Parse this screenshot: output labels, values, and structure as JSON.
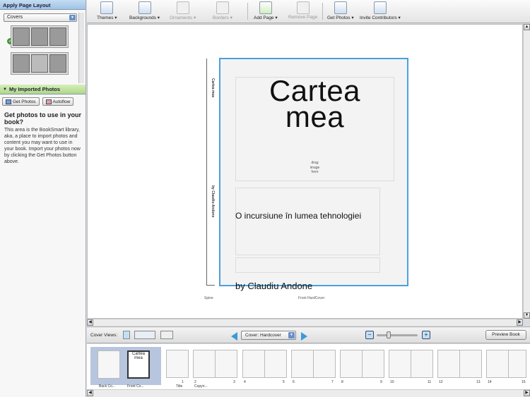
{
  "left_panel": {
    "header": "Apply Page Layout",
    "layout_select": "Covers",
    "photos_header": "My Imported Photos",
    "get_photos_btn": "Get Photos",
    "autoflow_btn": "Autoflow",
    "help_title": "Get photos to use in your book?",
    "help_body": "This area is the BookSmart library, aka, a place to import photos and content you may want to use in your book. Import your photos now by clicking the Get Photos button above."
  },
  "toolbar": {
    "themes": "Themes ▾",
    "backgrounds": "Backgrounds ▾",
    "ornaments": "Ornaments ▾",
    "borders": "Borders ▾",
    "add_page": "Add Page ▾",
    "remove_page": "Remove Page",
    "get_photos": "Get Photos ▾",
    "invite": "Invite Contributors ▾"
  },
  "cover": {
    "title_line1": "Cartea",
    "title_line2": "mea",
    "drag_hint_1": "drag",
    "drag_hint_2": "image",
    "drag_hint_3": "here",
    "subtitle": "O incursiune în lumea tehnologiei",
    "author": "by Claudiu Andone",
    "spine_title": "Cartea mea",
    "spine_author": "by Claudiu Andone",
    "spine_caption": "Spine",
    "front_caption": "Front HardCover"
  },
  "nav": {
    "cover_views_label": "Cover Views:",
    "cover_select": "Cover: Hardcover",
    "preview_btn": "Preview Book"
  },
  "thumbnails": {
    "cover_label_1": "Back Co...",
    "cover_label_2": "Front Co...",
    "mini_title": "Cartea mea",
    "pages": [
      {
        "num": "1",
        "name": "Title"
      },
      {
        "num": "2",
        "name": "Copyri..."
      },
      {
        "num": "3",
        "name": ""
      },
      {
        "num": "4",
        "name": ""
      },
      {
        "num": "5",
        "name": ""
      },
      {
        "num": "6",
        "name": ""
      },
      {
        "num": "7",
        "name": ""
      },
      {
        "num": "8",
        "name": ""
      },
      {
        "num": "9",
        "name": ""
      },
      {
        "num": "10",
        "name": ""
      },
      {
        "num": "11",
        "name": ""
      },
      {
        "num": "12",
        "name": ""
      },
      {
        "num": "13",
        "name": ""
      },
      {
        "num": "14",
        "name": ""
      },
      {
        "num": "15",
        "name": ""
      }
    ]
  }
}
